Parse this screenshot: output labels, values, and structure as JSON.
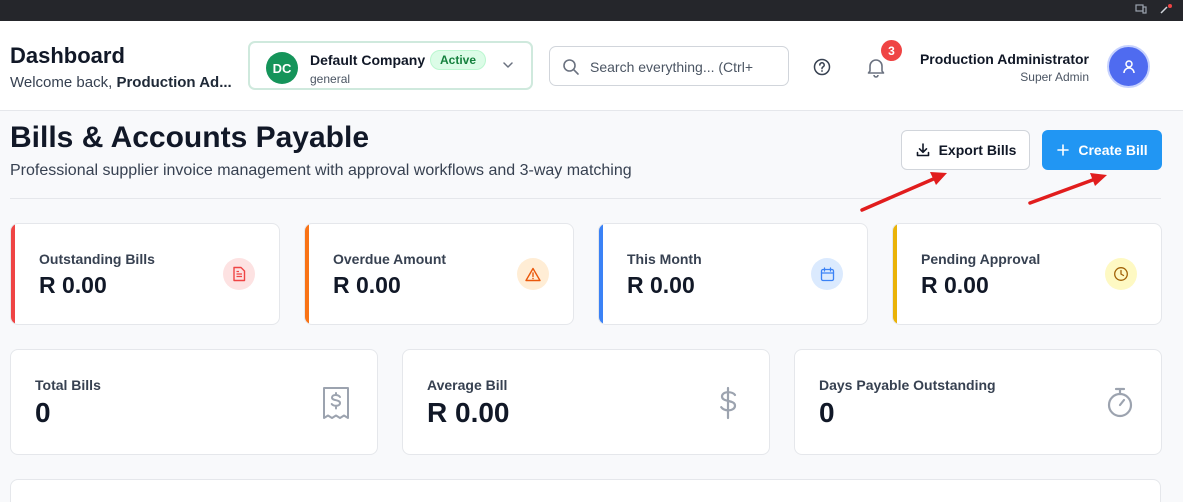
{
  "header": {
    "title": "Dashboard",
    "welcome_prefix": "Welcome back,",
    "welcome_name": "Production Ad...",
    "company": {
      "initials": "DC",
      "name": "Default Company",
      "status": "Active",
      "sub": "general"
    },
    "search": {
      "placeholder": "Search everything... (Ctrl+"
    },
    "notifications": {
      "count": "3"
    },
    "user": {
      "name": "Production Administrator",
      "role": "Super Admin"
    }
  },
  "page": {
    "title": "Bills & Accounts Payable",
    "subtitle": "Professional supplier invoice management with approval workflows and 3-way matching",
    "export_label": "Export Bills",
    "create_label": "Create Bill"
  },
  "stats_primary": [
    {
      "label": "Outstanding Bills",
      "value": "R 0.00",
      "accent": "#ef4444",
      "icon": "document-icon"
    },
    {
      "label": "Overdue Amount",
      "value": "R 0.00",
      "accent": "#f97316",
      "icon": "warning-icon"
    },
    {
      "label": "This Month",
      "value": "R 0.00",
      "accent": "#3b82f6",
      "icon": "calendar-icon"
    },
    {
      "label": "Pending Approval",
      "value": "R 0.00",
      "accent": "#eab308",
      "icon": "clock-icon"
    }
  ],
  "stats_secondary": [
    {
      "label": "Total Bills",
      "value": "0",
      "icon": "receipt-icon"
    },
    {
      "label": "Average Bill",
      "value": "R 0.00",
      "icon": "dollar-icon"
    },
    {
      "label": "Days Payable Outstanding",
      "value": "0",
      "icon": "stopwatch-icon"
    }
  ],
  "colors": {
    "primary": "#2196f3",
    "brand_green": "#15945a",
    "annotation_red": "#e11d1d"
  }
}
